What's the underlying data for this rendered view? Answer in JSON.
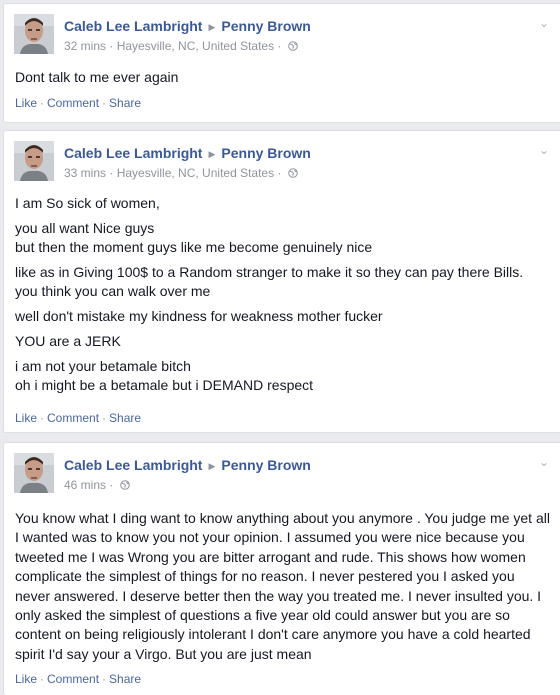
{
  "posts": [
    {
      "author": "Caleb Lee Lambright",
      "recipient": "Penny Brown",
      "time": "32 mins",
      "location": "Hayesville, NC, United States",
      "paragraphs": [
        "Dont talk to me ever again"
      ],
      "actions": [
        "Like",
        "Comment",
        "Share"
      ]
    },
    {
      "author": "Caleb Lee Lambright",
      "recipient": "Penny Brown",
      "time": "33 mins",
      "location": "Hayesville, NC, United States",
      "paragraphs": [
        "I am So sick of women,",
        "you all want Nice guys",
        "but then the moment guys like me become genuinely nice",
        "like as in Giving 100$ to a Random stranger to make it so they can pay there Bills.",
        "you think you can walk over me",
        "well don't mistake my kindness for weakness mother fucker",
        "YOU are a JERK",
        "i am not your betamale bitch",
        "oh i might be a betamale but i DEMAND respect"
      ],
      "actions": [
        "Like",
        "Comment",
        "Share"
      ]
    },
    {
      "author": "Caleb Lee Lambright",
      "recipient": "Penny Brown",
      "time": "46 mins",
      "location": "",
      "paragraphs": [
        "You know what I ding want to know anything about you anymore . You judge me yet all I wanted was to know you not your opinion. I assumed you were nice because you tweeted me I was Wrong you are bitter arrogant and rude. This shows how women complicate the simplest of things for no reason. I never pestered you I asked you never answered. I deserve better then the way you treated me. I never insulted you. I only asked the simplest of questions a five year old could answer but you are so content on being religiously intolerant I don't care anymore you have a cold hearted spirit I'd say your a Virgo. But you are just mean"
      ],
      "actions": [
        "Like",
        "Comment",
        "Share"
      ]
    }
  ],
  "icons": {
    "arrow": "right-triangle-icon",
    "globe": "globe-icon",
    "chevron": "chevron-down-icon"
  },
  "colors": {
    "link": "#3b5998",
    "meta": "#90949c",
    "background": "#e9ebee"
  }
}
